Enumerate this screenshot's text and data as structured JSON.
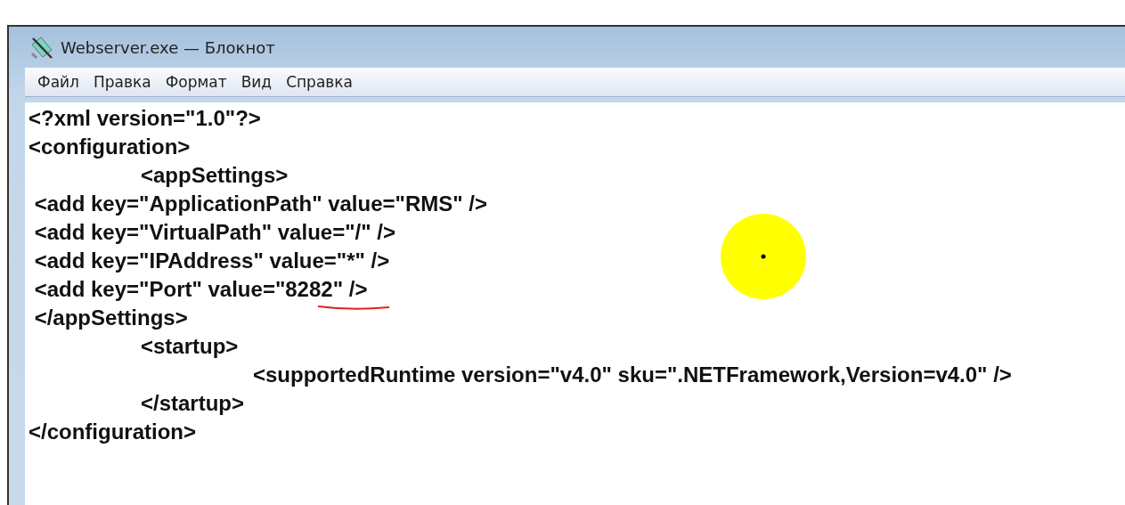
{
  "window": {
    "title": "Webserver.exe — Блокнот"
  },
  "menu": [
    {
      "label": "Файл"
    },
    {
      "label": "Правка"
    },
    {
      "label": "Формат"
    },
    {
      "label": "Вид"
    },
    {
      "label": "Справка"
    }
  ],
  "editor": {
    "lines": [
      "<?xml version=\"1.0\"?>",
      "<configuration>",
      "\t<appSettings>",
      " <add key=\"ApplicationPath\" value=\"RMS\" />",
      " <add key=\"VirtualPath\" value=\"/\" />",
      " <add key=\"IPAddress\" value=\"*\" />",
      " <add key=\"Port\" value=\"8282\" />",
      " </appSettings>",
      "\t<startup>",
      "\t\t<supportedRuntime version=\"v4.0\" sku=\".NETFramework,Version=v4.0\" />",
      "\t</startup>",
      "</configuration>"
    ]
  }
}
